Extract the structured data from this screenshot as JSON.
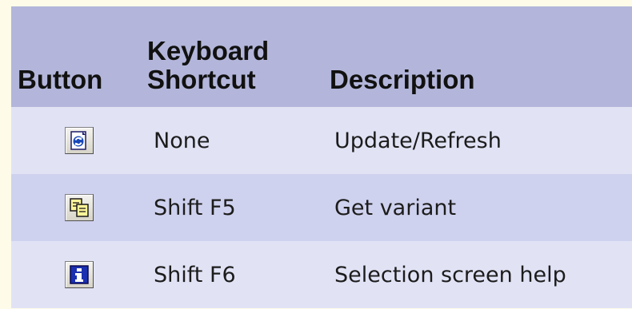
{
  "table": {
    "headers": {
      "button": "Button",
      "shortcut_line1": "Keyboard",
      "shortcut_line2": "Shortcut",
      "description": "Description"
    },
    "rows": [
      {
        "icon": "refresh-icon",
        "shortcut": "None",
        "description": "Update/Refresh"
      },
      {
        "icon": "get-variant-icon",
        "shortcut": "Shift F5",
        "description": "Get variant"
      },
      {
        "icon": "info-icon",
        "shortcut": "Shift F6",
        "description": "Selection screen help"
      }
    ]
  },
  "colors": {
    "header_bg": "#b3b6da",
    "row_light": "#e1e3f5",
    "row_dark": "#cfd2ee",
    "page_bg": "#fffbe9"
  }
}
